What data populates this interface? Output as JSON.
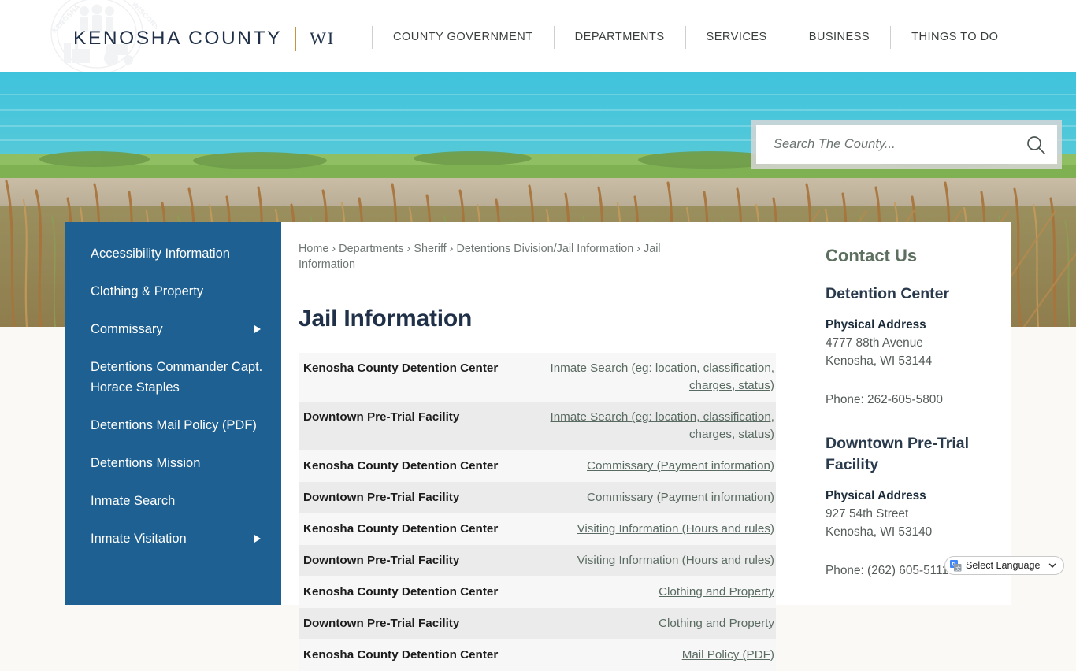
{
  "header": {
    "brand_main": "KENOSHA COUNTY",
    "brand_state": "WI",
    "seal_icon": "county-seal-watermark",
    "nav": [
      {
        "label": "COUNTY GOVERNMENT"
      },
      {
        "label": "DEPARTMENTS"
      },
      {
        "label": "SERVICES"
      },
      {
        "label": "BUSINESS"
      },
      {
        "label": "THINGS TO DO"
      }
    ]
  },
  "search": {
    "placeholder": "Search The County...",
    "value": "",
    "icon": "search-icon"
  },
  "sidebar": {
    "items": [
      {
        "label": "Accessibility Information",
        "has_submenu": false
      },
      {
        "label": "Clothing & Property",
        "has_submenu": false
      },
      {
        "label": "Commissary",
        "has_submenu": true
      },
      {
        "label": "Detentions Commander Capt. Horace Staples",
        "has_submenu": false
      },
      {
        "label": "Detentions Mail Policy (PDF)",
        "has_submenu": false
      },
      {
        "label": "Detentions Mission",
        "has_submenu": false
      },
      {
        "label": "Inmate Search",
        "has_submenu": false
      },
      {
        "label": "Inmate Visitation",
        "has_submenu": true
      }
    ]
  },
  "main": {
    "breadcrumb": "Home › Departments › Sheriff › Detentions Division/Jail Information › Jail Information",
    "title": "Jail Information",
    "rows": [
      {
        "facility": "Kenosha County Detention Center",
        "link": "Inmate Search (eg: location, classification, charges, status)"
      },
      {
        "facility": "Downtown Pre-Trial Facility",
        "link": "Inmate Search (eg: location, classification, charges, status)"
      },
      {
        "facility": "Kenosha County Detention Center",
        "link": "Commissary (Payment information)"
      },
      {
        "facility": "Downtown Pre-Trial Facility",
        "link": "Commissary (Payment information)"
      },
      {
        "facility": "Kenosha County Detention Center",
        "link": "Visiting Information (Hours and rules)"
      },
      {
        "facility": "Downtown Pre-Trial Facility",
        "link": "Visiting Information (Hours and rules)"
      },
      {
        "facility": "Kenosha County Detention Center",
        "link": "Clothing and Property"
      },
      {
        "facility": "Downtown Pre-Trial Facility",
        "link": "Clothing and Property"
      },
      {
        "facility": "Kenosha County Detention Center",
        "link": "Mail Policy (PDF)"
      }
    ]
  },
  "contact": {
    "heading": "Contact Us",
    "block1": {
      "name": "Detention Center",
      "address_label": "Physical Address",
      "address_line1": "4777 88th Avenue",
      "address_line2": "Kenosha, WI 53144",
      "phone": "Phone: 262-605-5800"
    },
    "block2": {
      "name": "Downtown Pre-Trial Facility",
      "address_label": "Physical Address",
      "address_line1": "927 54th Street",
      "address_line2": "Kenosha, WI 53140",
      "phone": "Phone: (262) 605-5111"
    }
  },
  "translate": {
    "label": "Select Language",
    "icon": "google-translate-icon",
    "chevron": "chevron-down-icon"
  },
  "colors": {
    "sidebar_blue": "#1d6091",
    "brand_navy": "#1f3048",
    "accent_gold": "#c6943f",
    "contact_green": "#5d7060",
    "link_gray_green": "#5a6b62",
    "page_bg": "#fbf9f6"
  }
}
